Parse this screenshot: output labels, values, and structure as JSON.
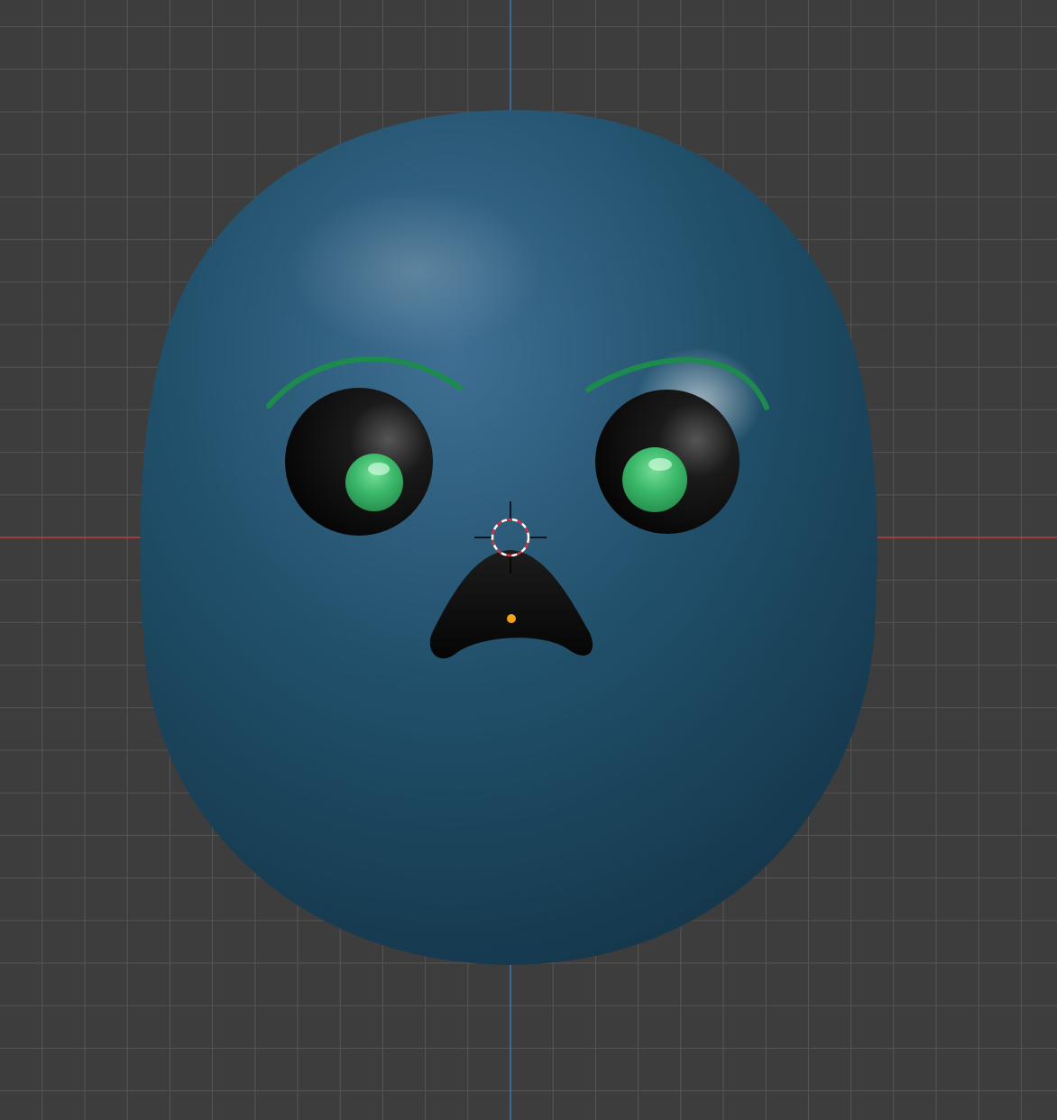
{
  "viewport": {
    "background": "#3d3d3d",
    "grid_color": "#555555",
    "x_axis_color": "#c43a45",
    "y_axis_color": "#3f77b8"
  },
  "object": {
    "body_color": "#1f4b63",
    "body_highlight": "#3e6f94",
    "eye_color": "#0d0d0d",
    "iris_color": "#3bb86a",
    "eyebrow_color": "#1d8a4e",
    "mouth_color": "#111111",
    "origin_color": "#f3a21a"
  },
  "icons": {
    "cursor": "3d-cursor-icon",
    "origin": "object-origin-icon"
  }
}
